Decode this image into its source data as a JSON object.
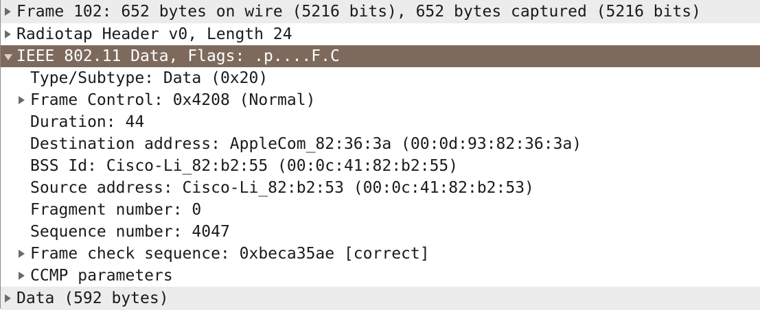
{
  "rows": [
    {
      "text": "Frame 102: 652 bytes on wire (5216 bits), 652 bytes captured (5216 bits)"
    },
    {
      "text": "Radiotap Header v0, Length 24"
    },
    {
      "text": "IEEE 802.11 Data, Flags: .p....F.C"
    },
    {
      "text": "Type/Subtype: Data (0x20)"
    },
    {
      "text": "Frame Control: 0x4208 (Normal)"
    },
    {
      "text": "Duration: 44"
    },
    {
      "text": "Destination address: AppleCom_82:36:3a (00:0d:93:82:36:3a)"
    },
    {
      "text": "BSS Id: Cisco-Li_82:b2:55 (00:0c:41:82:b2:55)"
    },
    {
      "text": "Source address: Cisco-Li_82:b2:53 (00:0c:41:82:b2:53)"
    },
    {
      "text": "Fragment number: 0"
    },
    {
      "text": "Sequence number: 4047"
    },
    {
      "text": "Frame check sequence: 0xbeca35ae [correct]"
    },
    {
      "text": "CCMP parameters"
    },
    {
      "text": "Data (592 bytes)"
    }
  ],
  "colors": {
    "selected_bg": "#7d6a5d",
    "alt_bg": "#ececec"
  },
  "icons": {
    "collapsed": "triangle-right-icon",
    "expanded": "triangle-down-icon"
  }
}
